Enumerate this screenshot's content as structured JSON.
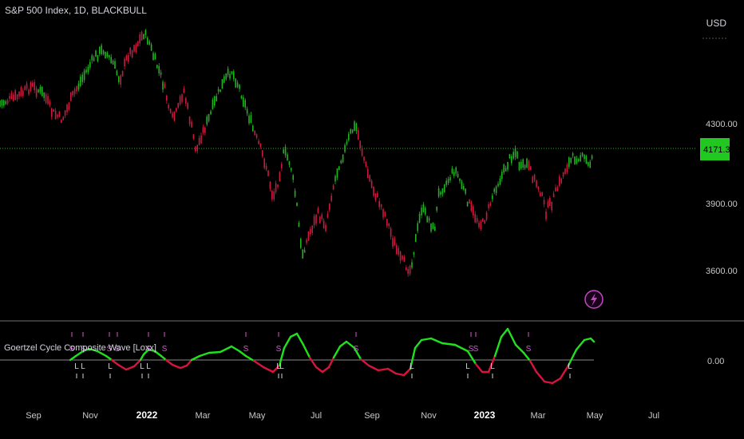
{
  "header": {
    "symbol_title": "S&P 500 Index, 1D, BLACKBULL",
    "currency": "USD"
  },
  "price_axis": {
    "ticks": [
      "4300.00",
      "3900.00",
      "3600.00"
    ],
    "last_price": "4171.30",
    "last_price_color": "#22c722"
  },
  "indicator": {
    "label": "Goertzel Cycle Composite Wave [Loxx]",
    "zero_tick": "0.00",
    "up_color": "#21e01d",
    "down_color": "#d6153f",
    "marker_color": "#d05ad0",
    "short_marker": "S",
    "long_marker": "L"
  },
  "time_axis": {
    "labels": [
      "Sep",
      "Nov",
      "2022",
      "Mar",
      "May",
      "Jul",
      "Sep",
      "Nov",
      "2023",
      "Mar",
      "May",
      "Jul"
    ]
  },
  "colors": {
    "bull": "#1fb51f",
    "bear": "#cc1a3f",
    "background": "#000000",
    "flash_icon": "#c04bc0"
  },
  "icons": {
    "flash": "lightning-icon"
  }
}
